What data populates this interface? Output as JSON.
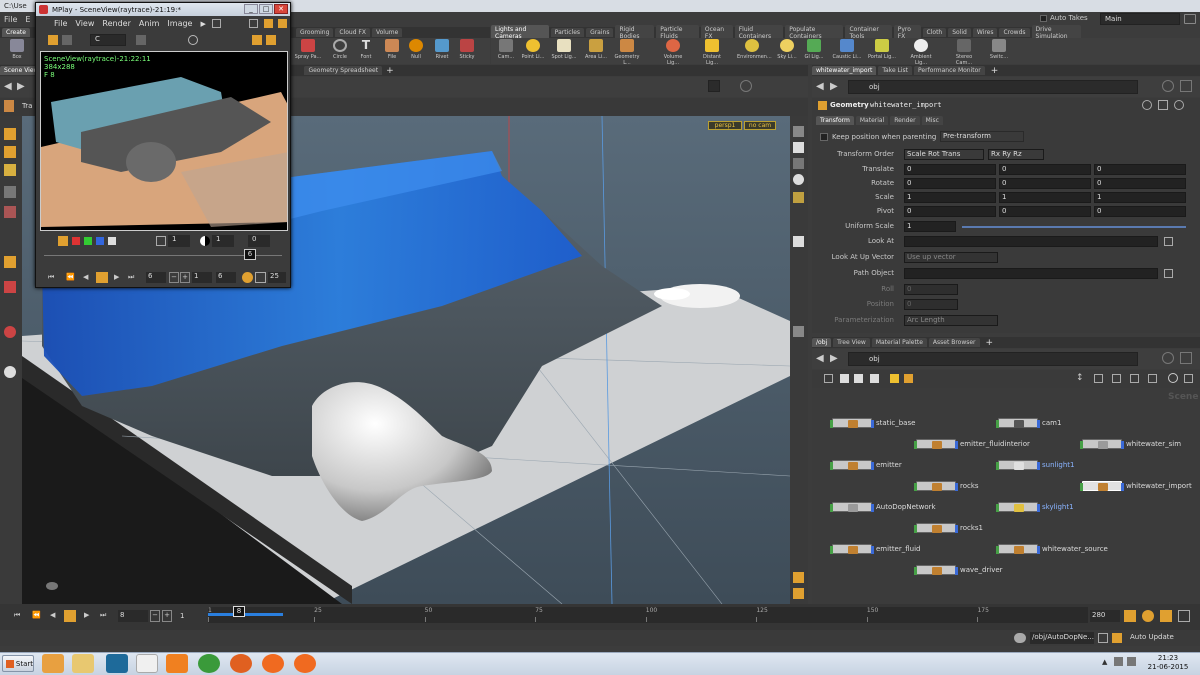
{
  "titlebar": {
    "title": "C:\\Use"
  },
  "menubar": {
    "items": [
      "File",
      "E"
    ]
  },
  "shelf_left": {
    "tabs": [
      "Create",
      "Grooming",
      "Cloud FX",
      "Volume"
    ],
    "tools": [
      "Box",
      "Spray Pa...",
      "Circle",
      "Font",
      "File",
      "Null",
      "Rivet",
      "Sticky"
    ]
  },
  "shelf_right": {
    "tabs": [
      "Lights and Cameras",
      "Particles",
      "Grains",
      "Rigid Bodies",
      "Particle Fluids",
      "Ocean FX",
      "Fluid Containers",
      "Populate Containers",
      "Container Tools",
      "Pyro FX",
      "Cloth",
      "Solid",
      "Wires",
      "Crowds",
      "Drive Simulation"
    ],
    "tools": [
      "Cam...",
      "Point Li...",
      "Spot Lig...",
      "Area Li...",
      "Geometry L...",
      "Volume Lig...",
      "Distant Lig...",
      "Environmen...",
      "Sky Li...",
      "GI Lig...",
      "Caustic Li...",
      "Portal Lig...",
      "Ambient Lig...",
      "Stereo Cam...",
      "Switc..."
    ]
  },
  "top_right": {
    "auto_takes": "Auto Takes",
    "desktop": "Main"
  },
  "viewport": {
    "tabs": [
      "Scene View",
      "Geometry Spreadsheet"
    ],
    "tool_label": "Tra",
    "camera": "persp1",
    "cam_menu": "no cam"
  },
  "mplay": {
    "title": "MPlay - SceneView(raytrace)-21:19:*",
    "menu": [
      "File",
      "View",
      "Render",
      "Anim",
      "Image"
    ],
    "channel": "C",
    "overlay": {
      "name": "SceneView(raytrace)-21:22:11",
      "res": "384x288",
      "frame": "F 8"
    },
    "fields": {
      "gamma": "1",
      "exposure": "0",
      "frame_marker": "6",
      "start": "6",
      "step": "1",
      "end": "6",
      "fps": "25"
    }
  },
  "params": {
    "tabs": [
      "whitewater_import",
      "Take List",
      "Performance Monitor"
    ],
    "path": "obj",
    "node_type": "Geometry",
    "node_name": "whitewater_import",
    "subtabs": [
      "Transform",
      "Material",
      "Render",
      "Misc"
    ],
    "keep_position": "Keep position when parenting",
    "keep_value": "Pre-transform",
    "rows": [
      {
        "label": "Transform Order",
        "v": [
          "Scale Rot Trans",
          "Rx Ry Rz"
        ]
      },
      {
        "label": "Translate",
        "v": [
          "0",
          "0",
          "0"
        ]
      },
      {
        "label": "Rotate",
        "v": [
          "0",
          "0",
          "0"
        ]
      },
      {
        "label": "Scale",
        "v": [
          "1",
          "1",
          "1"
        ]
      },
      {
        "label": "Pivot",
        "v": [
          "0",
          "0",
          "0"
        ]
      },
      {
        "label": "Uniform Scale",
        "v": [
          "1"
        ]
      },
      {
        "label": "Look At",
        "v": [
          ""
        ]
      },
      {
        "label": "Look At Up Vector",
        "v": [
          "Use up vector"
        ]
      },
      {
        "label": "Path Object",
        "v": [
          ""
        ]
      },
      {
        "label": "Roll",
        "v": [
          "0"
        ]
      },
      {
        "label": "Position",
        "v": [
          "0"
        ]
      },
      {
        "label": "Parameterization",
        "v": [
          "Arc Length"
        ]
      }
    ]
  },
  "network": {
    "tabs": [
      "/obj",
      "Tree View",
      "Material Palette",
      "Asset Browser"
    ],
    "path": "obj",
    "watermark": "Scene",
    "nodes": [
      {
        "name": "static_base",
        "icon": "#c08030",
        "col": 0,
        "row": 0
      },
      {
        "name": "cam1",
        "icon": "#555555",
        "col": 2,
        "row": 0
      },
      {
        "name": "emitter_fluidinterior",
        "icon": "#c08030",
        "col": 1,
        "row": 1
      },
      {
        "name": "whitewater_sim",
        "icon": "#9a9a9a",
        "col": 3,
        "row": 1
      },
      {
        "name": "emitter",
        "icon": "#c08030",
        "col": 0,
        "row": 2
      },
      {
        "name": "sunlight1",
        "icon": "#e0e0e0",
        "col": 2,
        "row": 2,
        "blue": true
      },
      {
        "name": "rocks",
        "icon": "#c08030",
        "col": 1,
        "row": 3
      },
      {
        "name": "whitewater_import",
        "icon": "#c08030",
        "col": 3,
        "row": 3,
        "selected": true
      },
      {
        "name": "AutoDopNetwork",
        "icon": "#9a9a9a",
        "col": 0,
        "row": 4
      },
      {
        "name": "skylight1",
        "icon": "#e0c040",
        "col": 2,
        "row": 4,
        "blue": true
      },
      {
        "name": "rocks1",
        "icon": "#c08030",
        "col": 1,
        "row": 5
      },
      {
        "name": "emitter_fluid",
        "icon": "#c08030",
        "col": 0,
        "row": 6
      },
      {
        "name": "whitewater_source",
        "icon": "#c08030",
        "col": 2,
        "row": 6
      },
      {
        "name": "wave_driver",
        "icon": "#c08030",
        "col": 1,
        "row": 7
      }
    ]
  },
  "timeline": {
    "current_frame": "8",
    "step": "1",
    "ticks": [
      "1",
      "25",
      "50",
      "75",
      "100",
      "125",
      "150",
      "175"
    ],
    "end_frame": "280",
    "frame_marker": "8",
    "range": [
      1,
      200
    ],
    "cached_until": 18
  },
  "status": {
    "path": "/obj/AutoDopNe...",
    "update_mode": "Auto Update"
  },
  "taskbar": {
    "start": "Start",
    "time": "21:23",
    "date": "21-06-2015"
  }
}
